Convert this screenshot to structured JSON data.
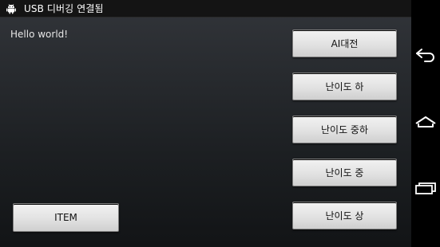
{
  "statusbar": {
    "title": "USB 디버깅 연결됨",
    "icon": "android-icon"
  },
  "main": {
    "hello_text": "Hello world!",
    "buttons": {
      "ai_battle": "AI대전",
      "difficulty_easy": "난이도 하",
      "difficulty_medium_easy": "난이도 중하",
      "difficulty_medium": "난이도 중",
      "difficulty_hard": "난이도 상",
      "item": "ITEM"
    }
  },
  "navbar": {
    "icons": [
      "back-icon",
      "home-icon",
      "recent-apps-icon"
    ]
  },
  "colors": {
    "background_top": "#32353a",
    "background_bottom": "#121416",
    "button_face": "#e2e2e2",
    "status_bar": "#141414"
  }
}
